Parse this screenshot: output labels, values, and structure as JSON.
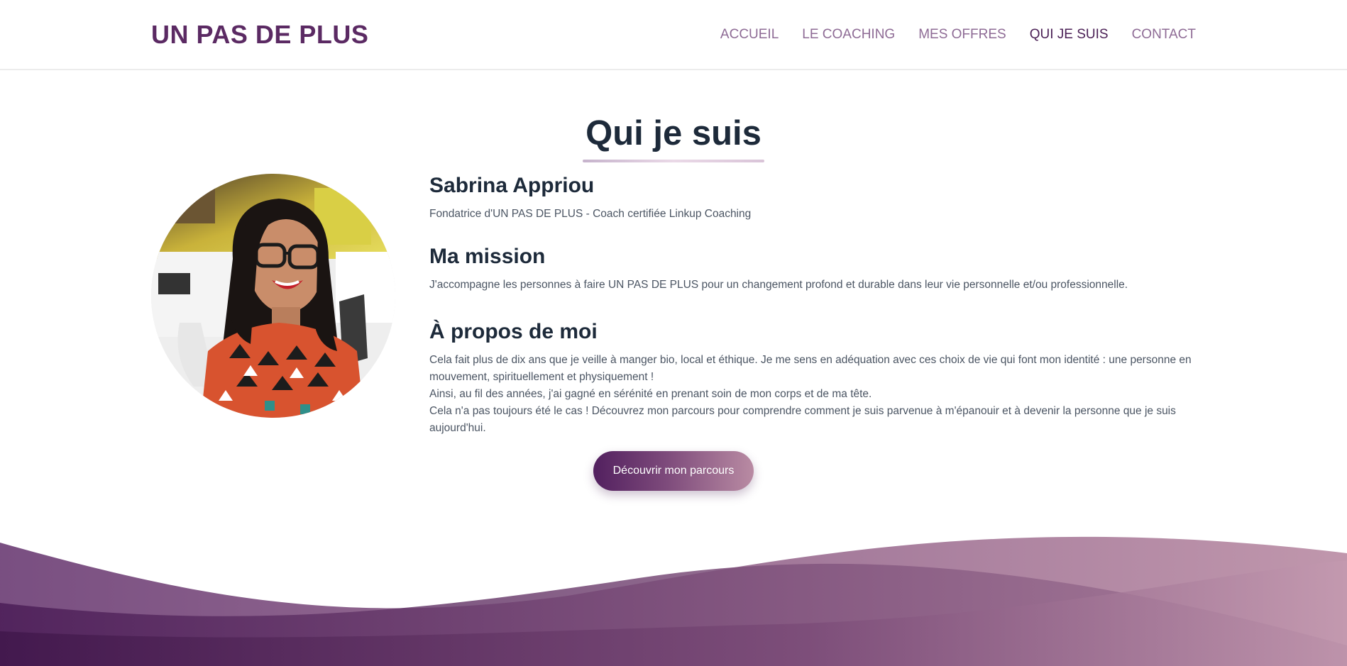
{
  "brand": {
    "logo_text": "UN PAS DE PLUS"
  },
  "nav": {
    "items": [
      {
        "label": "ACCUEIL"
      },
      {
        "label": "LE COACHING"
      },
      {
        "label": "MES OFFRES"
      },
      {
        "label": "QUI JE SUIS"
      },
      {
        "label": "CONTACT"
      }
    ],
    "active": "QUI JE SUIS"
  },
  "page": {
    "title": "Qui je suis"
  },
  "profile": {
    "name": "Sabrina Appriou",
    "subtitle": "Fondatrice d'UN PAS DE PLUS - Coach certifiée Linkup Coaching",
    "photo_alt": "Sabrina Appriou"
  },
  "mission": {
    "heading": "Ma mission",
    "text": "J'accompagne les personnes à faire UN PAS DE PLUS pour un changement profond et durable dans leur vie personnelle et/ou professionnelle."
  },
  "about": {
    "heading": "À propos de moi",
    "paragraph_1": "Cela fait plus de dix ans que je veille à manger bio, local et éthique. Je me sens en adéquation avec ces choix de vie qui font mon identité : une personne en mouvement, spirituellement et physiquement !",
    "paragraph_2": "Ainsi, au fil des années, j'ai gagné en sérénité en prenant soin de mon corps et de ma tête.",
    "paragraph_3": "Cela n'a pas toujours été le cas ! Découvrez mon parcours pour comprendre comment je suis parvenue à m'épanouir et à devenir la personne que je suis aujourd'hui."
  },
  "cta": {
    "label": "Découvrir mon parcours"
  },
  "colors": {
    "brand_purple": "#5b2a63",
    "nav_link": "#8e6b95",
    "heading": "#1d2a3a",
    "gradient_start": "#52205f",
    "gradient_end": "#b98ba3"
  }
}
